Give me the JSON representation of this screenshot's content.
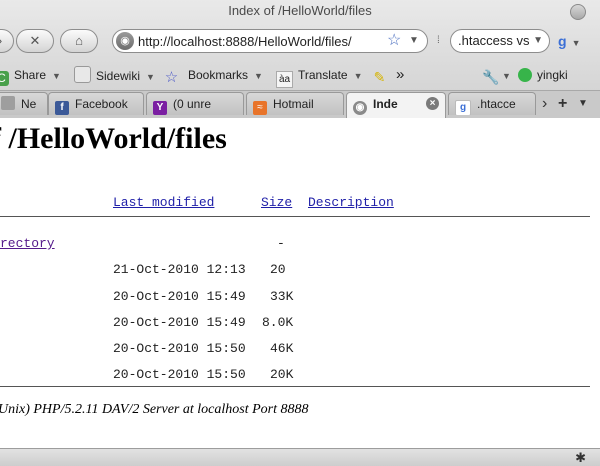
{
  "window": {
    "title": "Index of /HelloWorld/files"
  },
  "nav": {
    "url": "http://localhost:8888/HelloWorld/files/",
    "search_value": ".htaccess vs"
  },
  "bookmarks": [
    {
      "label": "Share",
      "icon": "share-icon"
    },
    {
      "label": "Sidewiki",
      "icon": "sidewiki-icon"
    },
    {
      "label": "Bookmarks",
      "icon": "star-icon"
    },
    {
      "label": "Translate",
      "icon": "translate-icon"
    }
  ],
  "bookmarks_extra": {
    "user": "yingki"
  },
  "tabs": [
    {
      "label": "Ne",
      "icon": "page-icon"
    },
    {
      "label": "Facebook",
      "icon": "facebook-icon"
    },
    {
      "label": "(0 unre",
      "icon": "yahoo-icon"
    },
    {
      "label": "Hotmail",
      "icon": "hotmail-icon"
    },
    {
      "label": "Inde",
      "icon": "globe-icon",
      "active": true
    },
    {
      "label": ".htacce",
      "icon": "google-icon"
    }
  ],
  "page": {
    "heading": "f /HelloWorld/files",
    "columns": {
      "last_modified": "Last modified",
      "size": "Size",
      "description": "Description"
    },
    "parent": {
      "name": "rectory",
      "size": "-"
    },
    "rows": [
      {
        "modified": "21-Oct-2010 12:13",
        "size": "20"
      },
      {
        "modified": "20-Oct-2010 15:49",
        "size": "33K"
      },
      {
        "modified": "20-Oct-2010 15:49",
        "size": "8.0K"
      },
      {
        "modified": "20-Oct-2010 15:50",
        "size": "46K"
      },
      {
        "modified": "20-Oct-2010 15:50",
        "size": "20K"
      }
    ],
    "footer": "Unix) PHP/5.2.11 DAV/2 Server at localhost Port 8888"
  }
}
